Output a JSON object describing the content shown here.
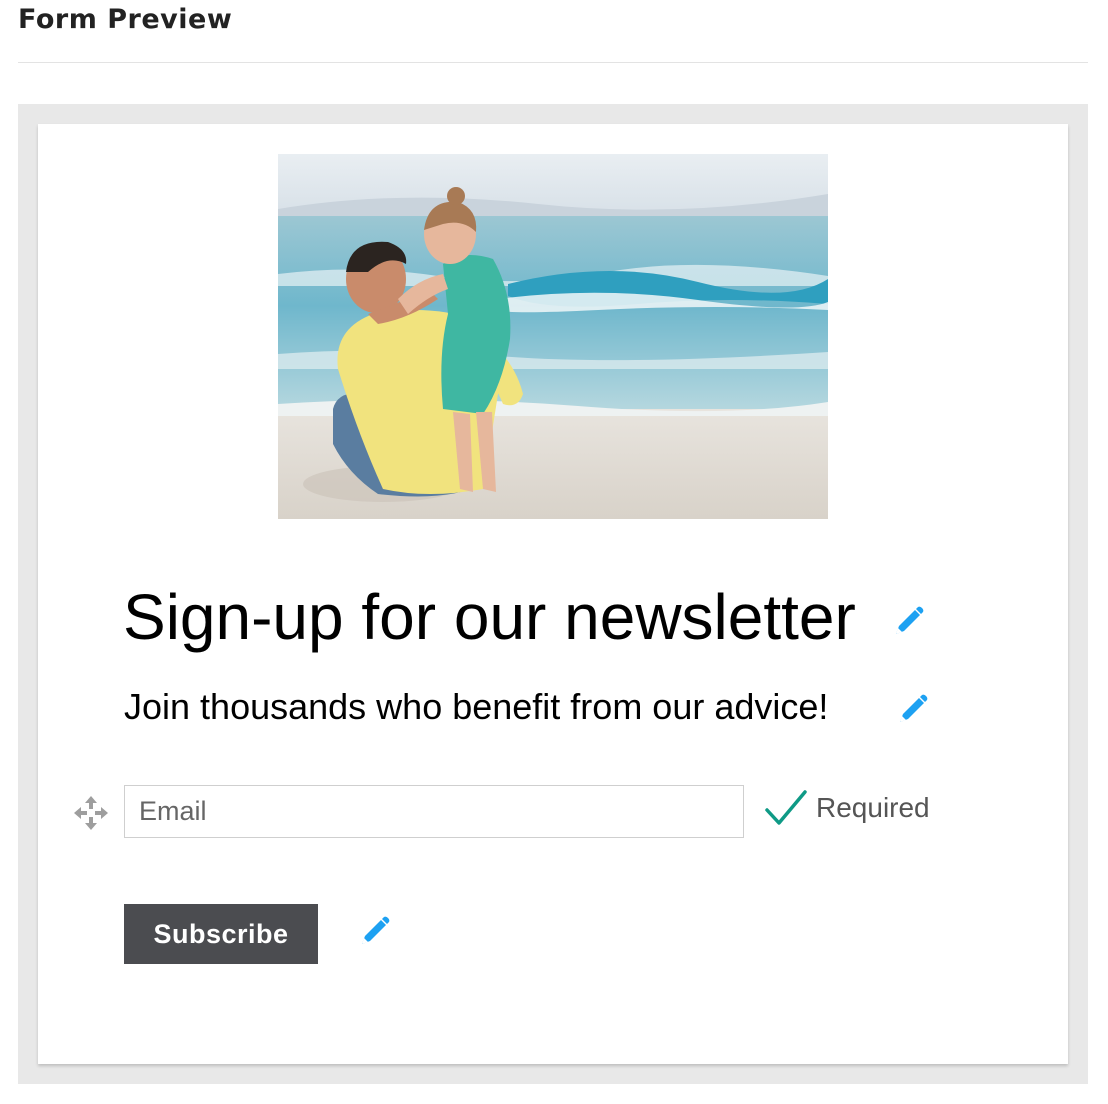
{
  "page": {
    "title": "Form Preview"
  },
  "hero_image": {
    "alt": "Father and daughter hugging on the beach"
  },
  "form": {
    "heading": "Sign-up for our newsletter",
    "subheading": "Join thousands who benefit from our advice!",
    "email_field": {
      "placeholder": "Email",
      "value": "",
      "required_label": "Required",
      "required": true
    },
    "submit_label": "Subscribe"
  },
  "icons": {
    "edit": "pencil-icon",
    "move": "move-arrows-icon",
    "required": "check-icon"
  },
  "colors": {
    "accent_blue": "#1da1f2",
    "check_green": "#0f9a86",
    "button_bg": "#4b4c50",
    "frame_bg": "#e8e8e8"
  }
}
